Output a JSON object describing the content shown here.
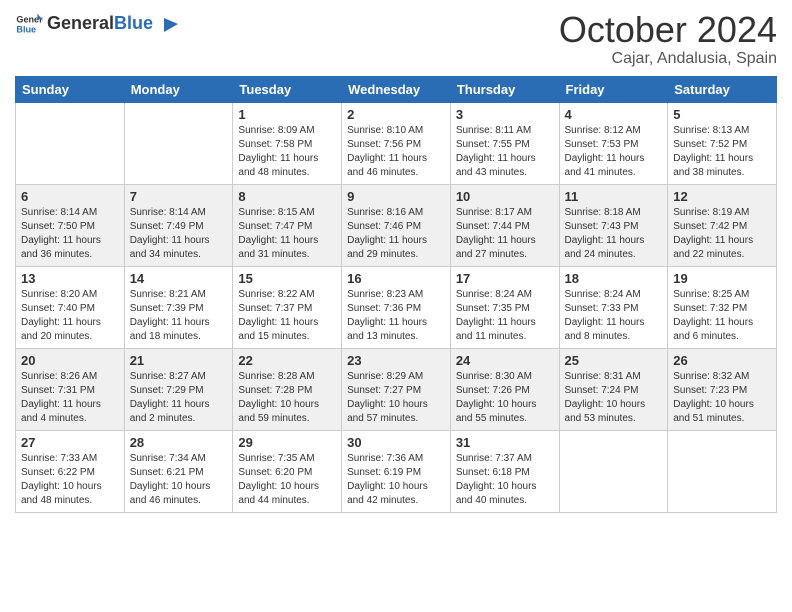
{
  "header": {
    "logo_general": "General",
    "logo_blue": "Blue",
    "month": "October 2024",
    "location": "Cajar, Andalusia, Spain"
  },
  "days_of_week": [
    "Sunday",
    "Monday",
    "Tuesday",
    "Wednesday",
    "Thursday",
    "Friday",
    "Saturday"
  ],
  "weeks": [
    [
      {
        "day": "",
        "details": ""
      },
      {
        "day": "",
        "details": ""
      },
      {
        "day": "1",
        "details": "Sunrise: 8:09 AM\nSunset: 7:58 PM\nDaylight: 11 hours and 48 minutes."
      },
      {
        "day": "2",
        "details": "Sunrise: 8:10 AM\nSunset: 7:56 PM\nDaylight: 11 hours and 46 minutes."
      },
      {
        "day": "3",
        "details": "Sunrise: 8:11 AM\nSunset: 7:55 PM\nDaylight: 11 hours and 43 minutes."
      },
      {
        "day": "4",
        "details": "Sunrise: 8:12 AM\nSunset: 7:53 PM\nDaylight: 11 hours and 41 minutes."
      },
      {
        "day": "5",
        "details": "Sunrise: 8:13 AM\nSunset: 7:52 PM\nDaylight: 11 hours and 38 minutes."
      }
    ],
    [
      {
        "day": "6",
        "details": "Sunrise: 8:14 AM\nSunset: 7:50 PM\nDaylight: 11 hours and 36 minutes."
      },
      {
        "day": "7",
        "details": "Sunrise: 8:14 AM\nSunset: 7:49 PM\nDaylight: 11 hours and 34 minutes."
      },
      {
        "day": "8",
        "details": "Sunrise: 8:15 AM\nSunset: 7:47 PM\nDaylight: 11 hours and 31 minutes."
      },
      {
        "day": "9",
        "details": "Sunrise: 8:16 AM\nSunset: 7:46 PM\nDaylight: 11 hours and 29 minutes."
      },
      {
        "day": "10",
        "details": "Sunrise: 8:17 AM\nSunset: 7:44 PM\nDaylight: 11 hours and 27 minutes."
      },
      {
        "day": "11",
        "details": "Sunrise: 8:18 AM\nSunset: 7:43 PM\nDaylight: 11 hours and 24 minutes."
      },
      {
        "day": "12",
        "details": "Sunrise: 8:19 AM\nSunset: 7:42 PM\nDaylight: 11 hours and 22 minutes."
      }
    ],
    [
      {
        "day": "13",
        "details": "Sunrise: 8:20 AM\nSunset: 7:40 PM\nDaylight: 11 hours and 20 minutes."
      },
      {
        "day": "14",
        "details": "Sunrise: 8:21 AM\nSunset: 7:39 PM\nDaylight: 11 hours and 18 minutes."
      },
      {
        "day": "15",
        "details": "Sunrise: 8:22 AM\nSunset: 7:37 PM\nDaylight: 11 hours and 15 minutes."
      },
      {
        "day": "16",
        "details": "Sunrise: 8:23 AM\nSunset: 7:36 PM\nDaylight: 11 hours and 13 minutes."
      },
      {
        "day": "17",
        "details": "Sunrise: 8:24 AM\nSunset: 7:35 PM\nDaylight: 11 hours and 11 minutes."
      },
      {
        "day": "18",
        "details": "Sunrise: 8:24 AM\nSunset: 7:33 PM\nDaylight: 11 hours and 8 minutes."
      },
      {
        "day": "19",
        "details": "Sunrise: 8:25 AM\nSunset: 7:32 PM\nDaylight: 11 hours and 6 minutes."
      }
    ],
    [
      {
        "day": "20",
        "details": "Sunrise: 8:26 AM\nSunset: 7:31 PM\nDaylight: 11 hours and 4 minutes."
      },
      {
        "day": "21",
        "details": "Sunrise: 8:27 AM\nSunset: 7:29 PM\nDaylight: 11 hours and 2 minutes."
      },
      {
        "day": "22",
        "details": "Sunrise: 8:28 AM\nSunset: 7:28 PM\nDaylight: 10 hours and 59 minutes."
      },
      {
        "day": "23",
        "details": "Sunrise: 8:29 AM\nSunset: 7:27 PM\nDaylight: 10 hours and 57 minutes."
      },
      {
        "day": "24",
        "details": "Sunrise: 8:30 AM\nSunset: 7:26 PM\nDaylight: 10 hours and 55 minutes."
      },
      {
        "day": "25",
        "details": "Sunrise: 8:31 AM\nSunset: 7:24 PM\nDaylight: 10 hours and 53 minutes."
      },
      {
        "day": "26",
        "details": "Sunrise: 8:32 AM\nSunset: 7:23 PM\nDaylight: 10 hours and 51 minutes."
      }
    ],
    [
      {
        "day": "27",
        "details": "Sunrise: 7:33 AM\nSunset: 6:22 PM\nDaylight: 10 hours and 48 minutes."
      },
      {
        "day": "28",
        "details": "Sunrise: 7:34 AM\nSunset: 6:21 PM\nDaylight: 10 hours and 46 minutes."
      },
      {
        "day": "29",
        "details": "Sunrise: 7:35 AM\nSunset: 6:20 PM\nDaylight: 10 hours and 44 minutes."
      },
      {
        "day": "30",
        "details": "Sunrise: 7:36 AM\nSunset: 6:19 PM\nDaylight: 10 hours and 42 minutes."
      },
      {
        "day": "31",
        "details": "Sunrise: 7:37 AM\nSunset: 6:18 PM\nDaylight: 10 hours and 40 minutes."
      },
      {
        "day": "",
        "details": ""
      },
      {
        "day": "",
        "details": ""
      }
    ]
  ]
}
